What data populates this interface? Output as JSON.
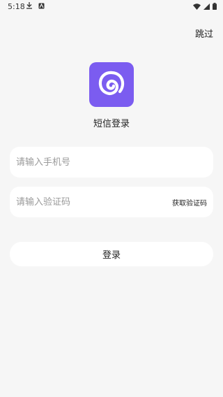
{
  "status_bar": {
    "time": "5:18",
    "left_icons": [
      "download-icon",
      "notification-icon"
    ],
    "right_icons": [
      "wifi-icon",
      "signal-icon",
      "battery-icon"
    ]
  },
  "header": {
    "skip_label": "跳过"
  },
  "logo": {
    "icon": "app-logo-icon",
    "color": "#7b5cf0"
  },
  "title": "短信登录",
  "form": {
    "phone_placeholder": "请输入手机号",
    "phone_value": "",
    "code_placeholder": "请输入验证码",
    "code_value": "",
    "get_code_label": "获取验证码"
  },
  "login_button_label": "登录"
}
